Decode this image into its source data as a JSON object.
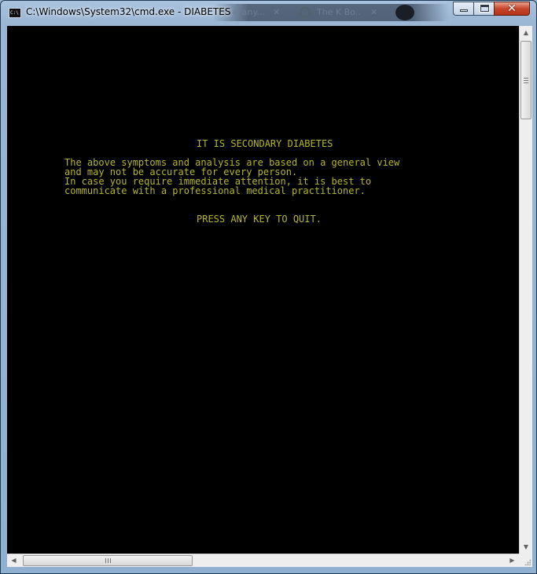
{
  "window": {
    "title": "C:\\Windows\\System32\\cmd.exe - DIABETES",
    "icon_label": "C:\\",
    "controls": {
      "minimize_icon": "minimize-icon",
      "maximize_icon": "maximize-icon",
      "close_glyph": "✕"
    }
  },
  "background_tabs": [
    {
      "label": "Diaw any..."
    },
    {
      "label": "The K Bo..."
    }
  ],
  "console": {
    "text_color": "#b6b62a",
    "background": "#000000",
    "heading": "IT IS SECONDARY DIABETES",
    "lines": [
      "The above symptoms and analysis are based on a general view",
      "and may not be accurate for every person.",
      "In case you require immediate attention, it is best to",
      "communicate with a professional medical practitioner."
    ],
    "prompt": "PRESS ANY KEY TO QUIT."
  },
  "scrollbars": {
    "vertical": {
      "up_glyph": "▲",
      "down_glyph": "▼",
      "grip": "≡"
    },
    "horizontal": {
      "left_glyph": "◀",
      "right_glyph": "▶",
      "grip": "|||"
    }
  }
}
